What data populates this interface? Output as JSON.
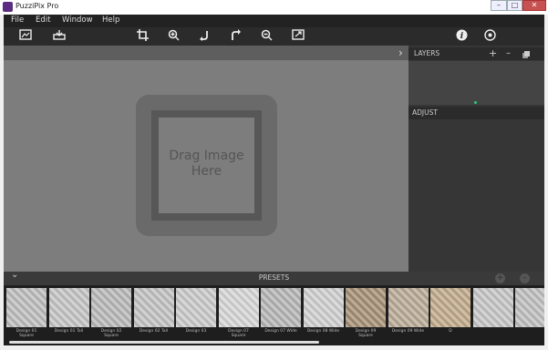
{
  "window": {
    "title": "PuzziPix Pro",
    "controls": {
      "minimize": "–",
      "maximize": "□",
      "close": "✕"
    }
  },
  "menu": [
    "File",
    "Edit",
    "Window",
    "Help"
  ],
  "toolbar": {
    "left_icons": [
      "open-image-icon",
      "save-icon"
    ],
    "center_icons": [
      "crop-icon",
      "zoom-in-icon",
      "rotate-left-icon",
      "rotate-right-icon",
      "zoom-out-icon",
      "export-icon"
    ],
    "right_icons": [
      "info-icon",
      "settings-icon"
    ]
  },
  "canvas": {
    "drop_text": "Drag Image\nHere"
  },
  "sidebar": {
    "collapse_glyph": "›",
    "layers_title": "LAYERS",
    "layers_add": "+",
    "layers_remove": "–",
    "adjust_title": "ADJUST"
  },
  "presets": {
    "toggle_glyph": "⌄",
    "title": "PRESETS",
    "add": "+",
    "remove": "–",
    "items": [
      {
        "label": "Design 01\nSquare",
        "color": "#bdbdbd"
      },
      {
        "label": "Design 01 Tall",
        "color": "#c4c4c4"
      },
      {
        "label": "Design 02\nSquare",
        "color": "#b8b8b8"
      },
      {
        "label": "Design 02 Tall",
        "color": "#c2c2c2"
      },
      {
        "label": "Design 03",
        "color": "#cacaca"
      },
      {
        "label": "Design 07\nSquare",
        "color": "#d6d6d6"
      },
      {
        "label": "Design 07 Wide",
        "color": "#b5b5b5"
      },
      {
        "label": "Design 08 Wide",
        "color": "#cfcfcf"
      },
      {
        "label": "Design 09\nSquare",
        "color": "#a48f74"
      },
      {
        "label": "Design 09 Wide",
        "color": "#b9aa95"
      },
      {
        "label": "D",
        "color": "#c0a98a"
      },
      {
        "label": "",
        "color": "#c6c6c6"
      },
      {
        "label": "",
        "color": "#bfbfbf"
      }
    ]
  }
}
